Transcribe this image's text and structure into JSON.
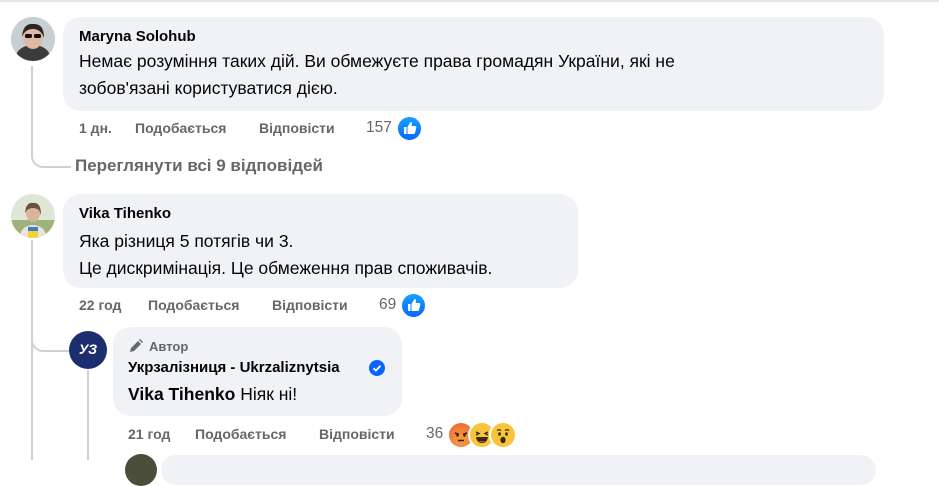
{
  "comments": [
    {
      "author": "Maryna Solohub",
      "lines": [
        "Немає розуміння таких дій. Ви обмежуєте права громадян України, які не",
        "зобов'язані користуватися дією."
      ],
      "time": "1 дн.",
      "like_label": "Подобається",
      "reply_label": "Відповісти",
      "reaction_count": "157",
      "reaction_icons": [
        "like-icon"
      ]
    },
    {
      "author": "Vika Tihenko",
      "lines": [
        "Яка різниця 5 потягів чи 3.",
        "Це дискримінація. Це обмеження прав споживачів."
      ],
      "time": "22 год",
      "like_label": "Подобається",
      "reply_label": "Відповісти",
      "reaction_count": "69",
      "reaction_icons": [
        "like-icon"
      ]
    }
  ],
  "view_replies": "Переглянути всі 9 відповідей",
  "reply": {
    "badge": "Автор",
    "author": "Укрзалізниця - Ukrzaliznytsia",
    "verified_icon": "verified-badge-icon",
    "avatar_text": "УЗ",
    "mention": "Vika Tihenko",
    "text": " Ніяк ні!",
    "time": "21 год",
    "like_label": "Подобається",
    "reply_label": "Відповісти",
    "reaction_count": "36",
    "reaction_icons": [
      "angry-icon",
      "haha-icon",
      "wow-icon"
    ]
  },
  "colors": {
    "bubble": "#f0f2f5",
    "meta": "#65676b",
    "like_blue": "#0866ff",
    "uz_blue": "#1c2e6e",
    "thread_line": "#ced0d4"
  }
}
